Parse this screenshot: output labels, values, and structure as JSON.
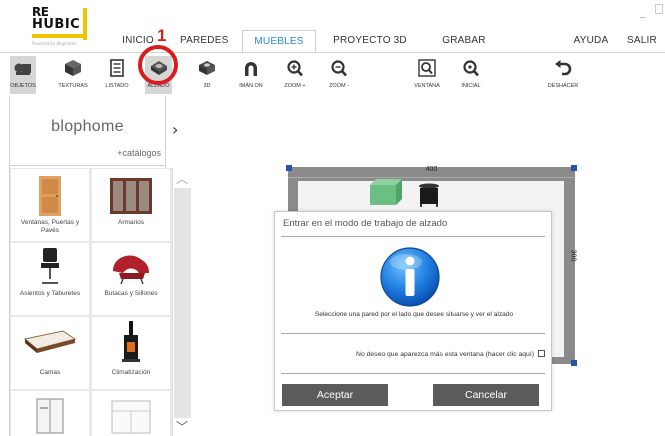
{
  "logo": {
    "line1": "RE",
    "line2": "HUBIC",
    "tagline": "Powered by Blophome"
  },
  "menu": {
    "items": [
      {
        "label": "INICIO",
        "active": false
      },
      {
        "label": "PAREDES",
        "active": false
      },
      {
        "label": "MUEBLES",
        "active": true
      },
      {
        "label": "PROYECTO 3D",
        "active": false
      },
      {
        "label": "GRABAR",
        "active": false
      },
      {
        "label": "AYUDA",
        "active": false
      },
      {
        "label": "SALIR",
        "active": false
      }
    ],
    "window_controls": {
      "minimize": "_"
    }
  },
  "annotation": {
    "number": "1",
    "color": "#d91c1c"
  },
  "toolbar": {
    "objetos": "OBJETOS",
    "texturas": "TEXTURAS",
    "listado": "LISTADO",
    "alzado": "ALZADO",
    "view3d": "3D",
    "iman": "IMÁN ON",
    "zoom_in": "ZOOM +",
    "zoom_out": "ZOOM -",
    "ventana": "VENTANA",
    "inicial": "INICIAL",
    "deshacer": "DESHACER"
  },
  "sidebar": {
    "brand": "blophome",
    "catalogs_link": "+catálogos",
    "categories": [
      {
        "label": "Ventanas, Puertas y Pavés",
        "icon": "door-icon"
      },
      {
        "label": "Armarios",
        "icon": "wardrobe-icon"
      },
      {
        "label": "Asientos y Taburetes",
        "icon": "chair-icon"
      },
      {
        "label": "Butacas y Sillones",
        "icon": "armchair-icon"
      },
      {
        "label": "Camas",
        "icon": "bed-icon"
      },
      {
        "label": "Climatización",
        "icon": "stove-icon"
      },
      {
        "label": "",
        "icon": "cabinet-icon"
      },
      {
        "label": "",
        "icon": "drawer-icon"
      }
    ]
  },
  "plan": {
    "width_label": "400",
    "height_label": "300"
  },
  "dialog": {
    "title": "Entrar en el modo de trabajo de alzado",
    "message": "Seleccione una pared por el lado que desee situarse y ver el alzado",
    "checkbox_label": "No deseo que aparezca más esta ventana (hacer clic aquí)",
    "checkbox_checked": false,
    "accept": "Aceptar",
    "cancel": "Cancelar"
  },
  "colors": {
    "accent": "#2e8bd8",
    "logo_yellow": "#f4c400",
    "annotation_red": "#d91c1c",
    "button_gray": "#5b5b5b"
  }
}
